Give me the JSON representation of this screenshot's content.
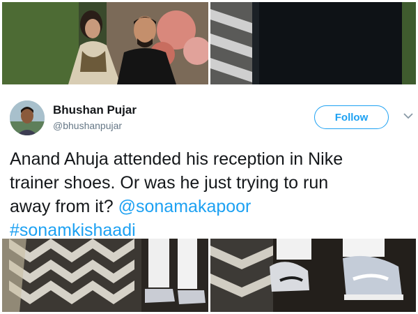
{
  "tweet": {
    "author_name": "Bhushan Pujar",
    "author_handle": "@bhushanpujar",
    "follow_label": "Follow",
    "text_line1": "Anand Ahuja attended his reception in Nike",
    "text_line2": "trainer shoes. Or was he just trying to run",
    "text_line3": "away from it?",
    "mention": "@sonamakapoor",
    "hashtag": "#sonamkishaadi"
  },
  "icons": {
    "avatar": "user-avatar",
    "more": "chevron-down-icon"
  },
  "colors": {
    "accent": "#1da1f2",
    "text": "#14171a",
    "muted": "#657786"
  }
}
